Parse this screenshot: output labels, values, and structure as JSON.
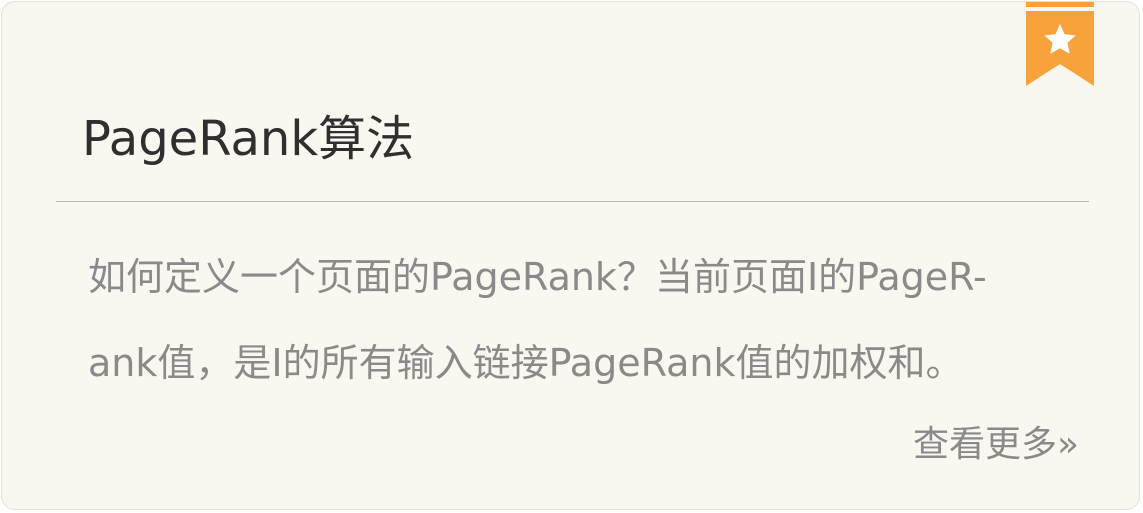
{
  "card": {
    "title": "PageRank算法",
    "description_lines": [
      "如何定义一个页面的PageRank？当前页面I的PageR-",
      "ank值，是I的所有输入链接PageRank值的加权和。"
    ],
    "more_link": "查看更多»"
  },
  "badge": {
    "icon": "star-bookmark-icon",
    "color": "#f7a23b"
  },
  "colors": {
    "background": "#faf7f0",
    "title": "#2f2f2f",
    "body_text": "#8a8a8a",
    "divider": "#bcbab6"
  }
}
